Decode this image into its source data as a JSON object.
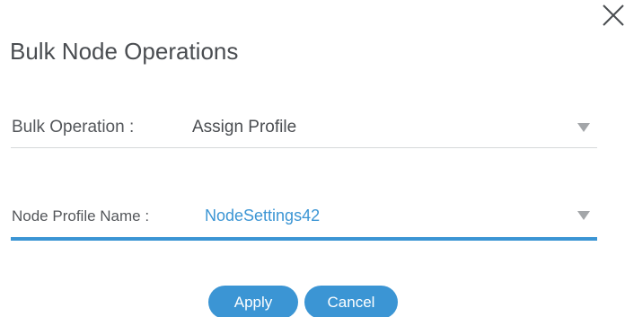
{
  "dialog": {
    "title": "Bulk Node Operations",
    "close_icon": "close-icon"
  },
  "bulk_operation": {
    "label": "Bulk Operation :",
    "value": "Assign Profile",
    "icon": "chevron-down-icon"
  },
  "node_profile": {
    "label": "Node Profile Name :",
    "value": "NodeSettings42",
    "icon": "chevron-down-icon"
  },
  "actions": {
    "apply_label": "Apply",
    "cancel_label": "Cancel"
  },
  "colors": {
    "accent": "#3b95d4",
    "text": "#4a4d51",
    "caret": "#a3a6a9",
    "divider": "#d6d8da"
  }
}
